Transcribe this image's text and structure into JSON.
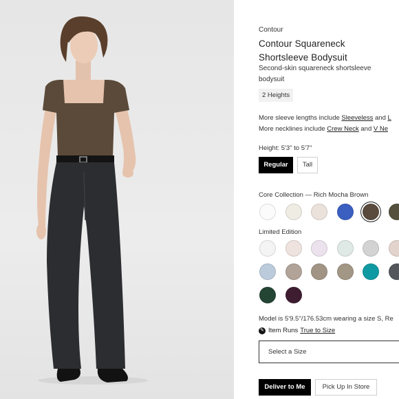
{
  "product": {
    "brand": "Contour",
    "title": "Contour Squareneck Shortsleeve Bodysuit",
    "subtitle": "Second-skin squareneck shortsleeve bodysuit",
    "tag": "2 Heights"
  },
  "more_options": {
    "sleeves_prefix": "More sleeve lengths include",
    "sleeves_link_1": "Sleeveless",
    "sleeves_and": "and",
    "sleeves_link_2": "L",
    "necklines_prefix": "More necklines include",
    "necklines_link_1": "Crew Neck",
    "necklines_and": "and",
    "necklines_link_2": "V Ne"
  },
  "height": {
    "label": "Height: 5'3\" to 5'7\"",
    "options": [
      "Regular",
      "Tall"
    ],
    "selected": "Regular"
  },
  "core_collection": {
    "label": "Core Collection — Rich Mocha Brown",
    "swatches": [
      {
        "name": "white",
        "color": "#fbfbfb"
      },
      {
        "name": "ivory",
        "color": "#efece4"
      },
      {
        "name": "blush",
        "color": "#ece2dc"
      },
      {
        "name": "royal blue",
        "color": "#3b5fc0"
      },
      {
        "name": "rich mocha brown",
        "color": "#5a4a3e",
        "selected": true
      },
      {
        "name": "olive",
        "color": "#55503d"
      }
    ]
  },
  "limited_edition": {
    "label": "Limited Edition",
    "swatches": [
      {
        "name": "white",
        "color": "#f4f4f4"
      },
      {
        "name": "pale pink",
        "color": "#eee3df"
      },
      {
        "name": "lavender",
        "color": "#ece2ee"
      },
      {
        "name": "mint",
        "color": "#dfe9e5"
      },
      {
        "name": "light grey",
        "color": "#d3d3d3"
      },
      {
        "name": "rose",
        "color": "#e3d3cd"
      },
      {
        "name": "powder blue",
        "color": "#bccbdc"
      },
      {
        "name": "taupe",
        "color": "#b1a398"
      },
      {
        "name": "mushroom",
        "color": "#a19484"
      },
      {
        "name": "stone",
        "color": "#a29684"
      },
      {
        "name": "teal",
        "color": "#0f9aa3"
      },
      {
        "name": "charcoal",
        "color": "#53575c"
      },
      {
        "name": "forest green",
        "color": "#244434"
      },
      {
        "name": "plum",
        "color": "#3e1d31"
      }
    ]
  },
  "model_info": "Model is 5'9.5\"/176.53cm wearing a size S, Re",
  "fit": {
    "prefix": "Item Runs",
    "link": "True to Size"
  },
  "size_select": {
    "placeholder": "Select a Size"
  },
  "delivery": {
    "deliver_label": "Deliver to Me",
    "pickup_label": "Pick Up In Store"
  }
}
